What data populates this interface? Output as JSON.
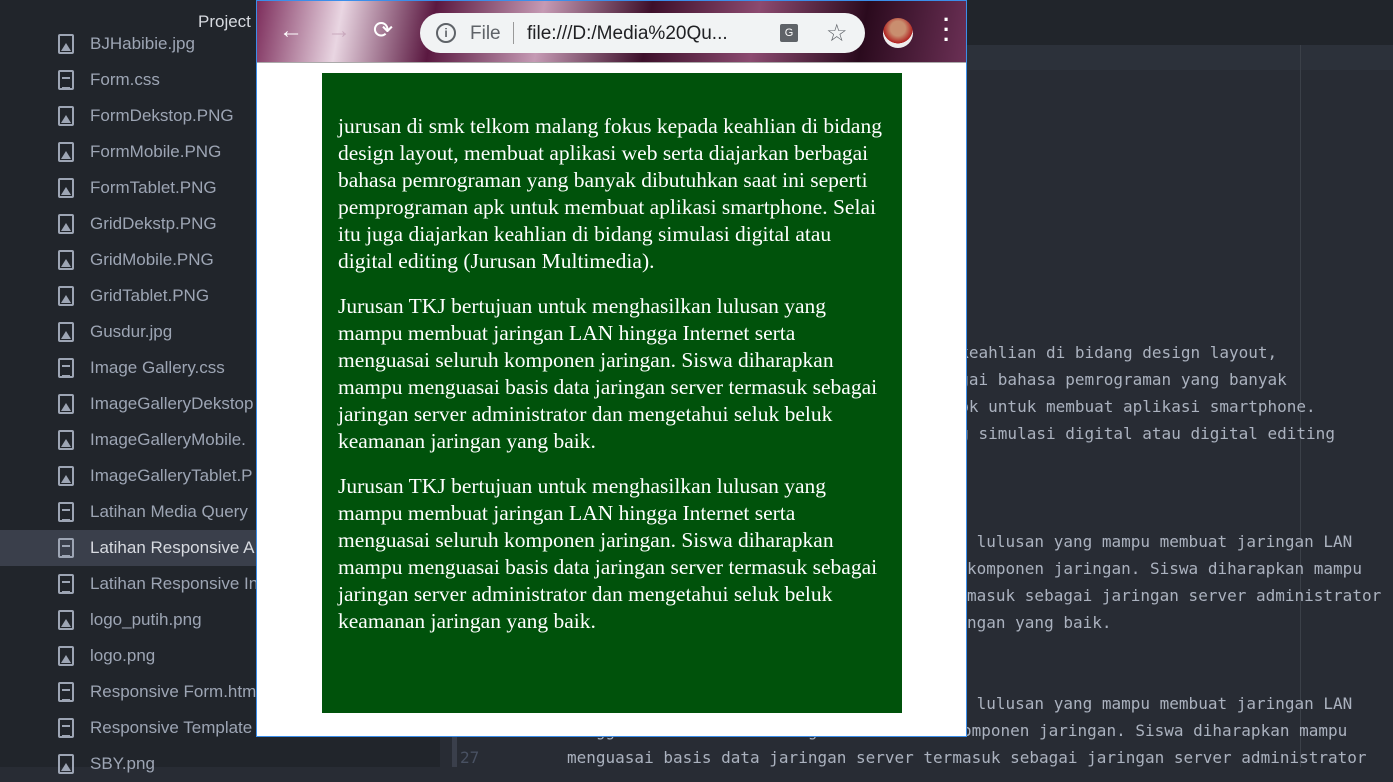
{
  "sidebar": {
    "title": "Project",
    "files": [
      {
        "name": "BJHabibie.jpg",
        "type": "image"
      },
      {
        "name": "Form.css",
        "type": "text"
      },
      {
        "name": "FormDekstop.PNG",
        "type": "image"
      },
      {
        "name": "FormMobile.PNG",
        "type": "image"
      },
      {
        "name": "FormTablet.PNG",
        "type": "image"
      },
      {
        "name": "GridDekstp.PNG",
        "type": "image"
      },
      {
        "name": "GridMobile.PNG",
        "type": "image"
      },
      {
        "name": "GridTablet.PNG",
        "type": "image"
      },
      {
        "name": "Gusdur.jpg",
        "type": "image"
      },
      {
        "name": "Image Gallery.css",
        "type": "text"
      },
      {
        "name": "ImageGalleryDekstop",
        "type": "image"
      },
      {
        "name": "ImageGalleryMobile.",
        "type": "image"
      },
      {
        "name": "ImageGalleryTablet.P",
        "type": "image"
      },
      {
        "name": "Latihan Media Query",
        "type": "text"
      },
      {
        "name": "Latihan Responsive A",
        "type": "text",
        "selected": true
      },
      {
        "name": "Latihan Responsive In",
        "type": "text"
      },
      {
        "name": "logo_putih.png",
        "type": "image"
      },
      {
        "name": "logo.png",
        "type": "image"
      },
      {
        "name": "Responsive Form.htm",
        "type": "text"
      },
      {
        "name": "Responsive Template",
        "type": "text"
      },
      {
        "name": "SBY.png",
        "type": "image"
      }
    ]
  },
  "editor": {
    "lines": [
      {
        "text": "a keahlian di bidang design layout,",
        "start": "right"
      },
      {
        "text": "bagai bahasa pemrograman yang banyak",
        "start": "right"
      },
      {
        "text": " apk untuk membuat aplikasi smartphone.",
        "start": "right"
      },
      {
        "text": "ang simulasi digital atau digital editing",
        "start": "right"
      },
      {
        "text": " lulusan yang mampu membuat jaringan LAN",
        "start": "right"
      },
      {
        "text": "komponen jaringan. Siswa diharapkan mampu",
        "start": "right"
      },
      {
        "text": "masuk sebagai jaringan server administrator",
        "start": "right"
      },
      {
        "text": "ngan yang baik.",
        "start": "right"
      },
      {
        "text": " lulusan yang mampu membuat jaringan LAN",
        "start": "right"
      },
      {
        "text": "hingga Internet serta menguasai seluruh komponen jaringan. Siswa diharapkan mampu",
        "start": "left"
      },
      {
        "text": "menguasai basis data jaringan server termasuk sebagai jaringan server administrator",
        "start": "left"
      }
    ],
    "line_number": "27"
  },
  "browser": {
    "url_scheme_label": "File",
    "url": "file:///D:/Media%20Qu...",
    "translate_icon": "G"
  },
  "page": {
    "paragraphs": [
      "jurusan di smk telkom malang fokus kepada keahlian di bidang design layout, membuat aplikasi web serta diajarkan berbagai bahasa pemrograman yang banyak dibutuhkan saat ini seperti pemprograman apk untuk membuat aplikasi smartphone. Selai itu juga diajarkan keahlian di bidang simulasi digital atau digital editing (Jurusan Multimedia).",
      "Jurusan TKJ bertujuan untuk menghasilkan lulusan yang mampu membuat jaringan LAN hingga Internet serta menguasai seluruh komponen jaringan. Siswa diharapkan mampu menguasai basis data jaringan server termasuk sebagai jaringan server administrator dan mengetahui seluk beluk keamanan jaringan yang baik.",
      "Jurusan TKJ bertujuan untuk menghasilkan lulusan yang mampu membuat jaringan LAN hingga Internet serta menguasai seluruh komponen jaringan. Siswa diharapkan mampu menguasai basis data jaringan server termasuk sebagai jaringan server administrator dan mengetahui seluk beluk keamanan jaringan yang baik."
    ],
    "bg_color": "#00520b"
  }
}
